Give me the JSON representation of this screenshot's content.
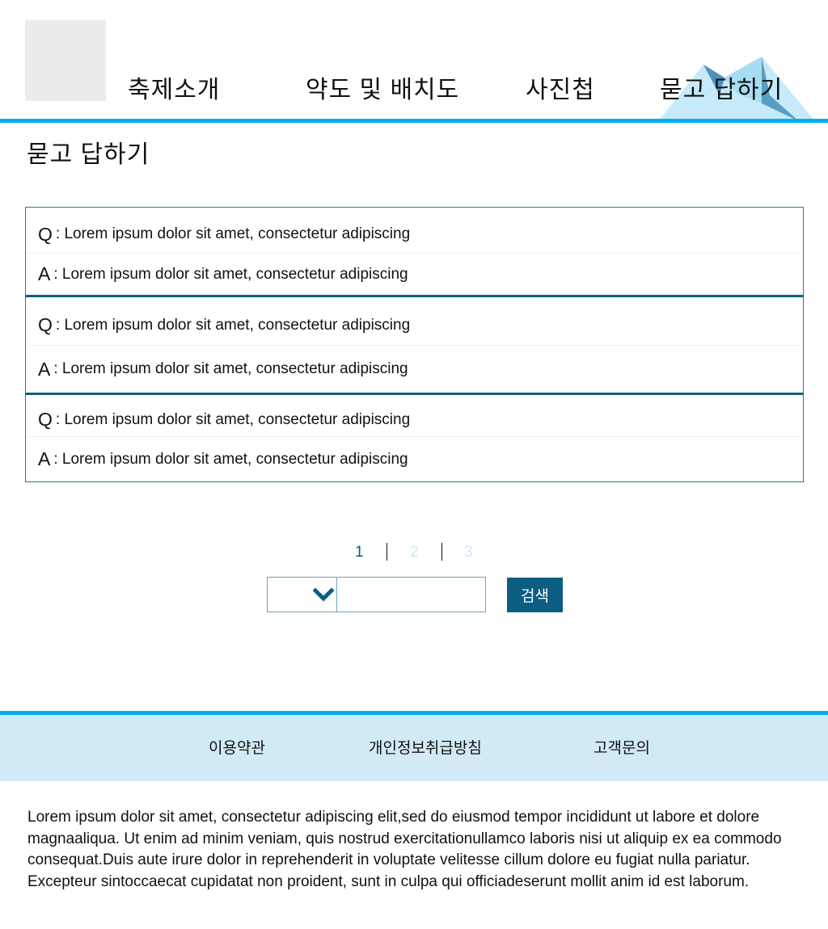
{
  "header": {
    "nav": [
      {
        "label": "축제소개"
      },
      {
        "label": "약도 및 배치도"
      },
      {
        "label": "사진첩"
      },
      {
        "label": "묻고 답하기"
      }
    ]
  },
  "page": {
    "title": "묻고 답하기"
  },
  "qa": [
    {
      "q_mark": "Q",
      "q_text": " : Lorem ipsum dolor sit amet, consectetur adipiscing",
      "a_mark": "A",
      "a_text": " : Lorem ipsum dolor sit amet, consectetur adipiscing"
    },
    {
      "q_mark": "Q",
      "q_text": " : Lorem ipsum dolor sit amet, consectetur adipiscing",
      "a_mark": "A",
      "a_text": " : Lorem ipsum dolor sit amet, consectetur adipiscing"
    },
    {
      "q_mark": "Q",
      "q_text": " : Lorem ipsum dolor sit amet, consectetur adipiscing",
      "a_mark": "A",
      "a_text": " : Lorem ipsum dolor sit amet, consectetur adipiscing"
    }
  ],
  "pagination": {
    "pages": [
      "1",
      "2",
      "3"
    ],
    "current": "1",
    "active_color": "#0d5f80",
    "inactive_color": "#cfe8f4"
  },
  "search": {
    "select_value": "",
    "input_value": "",
    "button_label": "검색"
  },
  "footer": {
    "links": [
      {
        "label": "이용약관"
      },
      {
        "label": "개인정보취급방침"
      },
      {
        "label": "고객문의"
      }
    ],
    "text": "Lorem ipsum dolor sit amet, consectetur adipiscing elit,sed do eiusmod tempor incididunt ut labore et dolore magnaaliqua. Ut enim ad minim veniam, quis nostrud exercitationullamco laboris nisi ut aliquip ex ea commodo consequat.Duis aute irure dolor in reprehenderit in voluptate velitesse cillum dolore eu fugiat nulla pariatur. Excepteur sintoccaecat cupidatat non proident, sunt in culpa qui officiadeserunt mollit anim id est laborum."
  },
  "colors": {
    "accent": "#00aeef",
    "dark_accent": "#0b5e82",
    "footer_bg": "#d2eaf5",
    "logo_placeholder": "#ebebeb"
  }
}
